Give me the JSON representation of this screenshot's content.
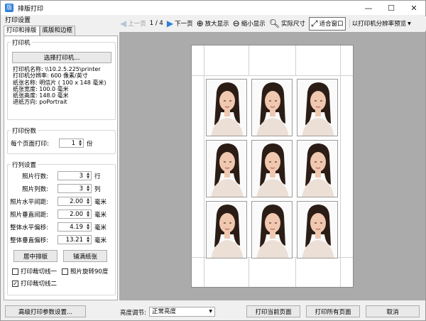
{
  "window": {
    "title": "排版打印"
  },
  "left": {
    "panel_title": "打印设置",
    "tabs": [
      "打印和排版",
      "底版和边框"
    ],
    "printer": {
      "group_label": "打印机",
      "select_button": "选择打印机...",
      "info": [
        "打印机名称: \\\\10.2.5.225\\printer",
        "打印机分辨率: 600 像素/英寸",
        "纸张名称: 明信片 ( 100 x 148 毫米)",
        "纸张宽度: 100.0 毫米",
        "纸张高度: 148.0 毫米",
        "进纸方向: poPortrait"
      ]
    },
    "copies": {
      "group_label": "打印份数",
      "label": "每个页面打印:",
      "value": "1",
      "unit": "份"
    },
    "layout": {
      "group_label": "行列设置",
      "fields": [
        {
          "label": "照片行数:",
          "value": "3",
          "unit": "行"
        },
        {
          "label": "照片列数:",
          "value": "3",
          "unit": "列"
        },
        {
          "label": "照片水平间距:",
          "value": "2.00",
          "unit": "毫米"
        },
        {
          "label": "照片垂直间距:",
          "value": "2.00",
          "unit": "毫米"
        },
        {
          "label": "整体水平偏移:",
          "value": "4.19",
          "unit": "毫米"
        },
        {
          "label": "整体垂直偏移:",
          "value": "13.21",
          "unit": "毫米"
        }
      ],
      "center_button": "居中排版",
      "fill_button": "铺满纸张",
      "checkboxes": [
        {
          "label": "打印裁切线一",
          "checked": false
        },
        {
          "label": "照片旋转90度",
          "checked": false
        },
        {
          "label": "打印裁切线二",
          "checked": true
        }
      ]
    }
  },
  "toolbar": {
    "prev": "上一页",
    "page_indicator": "1 / 4",
    "next": "下一页",
    "zoom_in": "放大显示",
    "zoom_out": "缩小显示",
    "actual_size": "实际尺寸",
    "fit_window": "适合窗口",
    "preview_mode": "以打印机分辨率预览"
  },
  "bottom": {
    "advanced_button": "高级打印参数设置...",
    "brightness_label": "亮度调节:",
    "brightness_value": "正常亮度",
    "print_current": "打印当前页面",
    "print_all": "打印所有页面",
    "cancel": "取消"
  },
  "colors": {
    "preview_bg": "#ababab",
    "accent": "#2f7fd8",
    "hair": "#2b1d16",
    "skin": "#f0c8b0"
  }
}
